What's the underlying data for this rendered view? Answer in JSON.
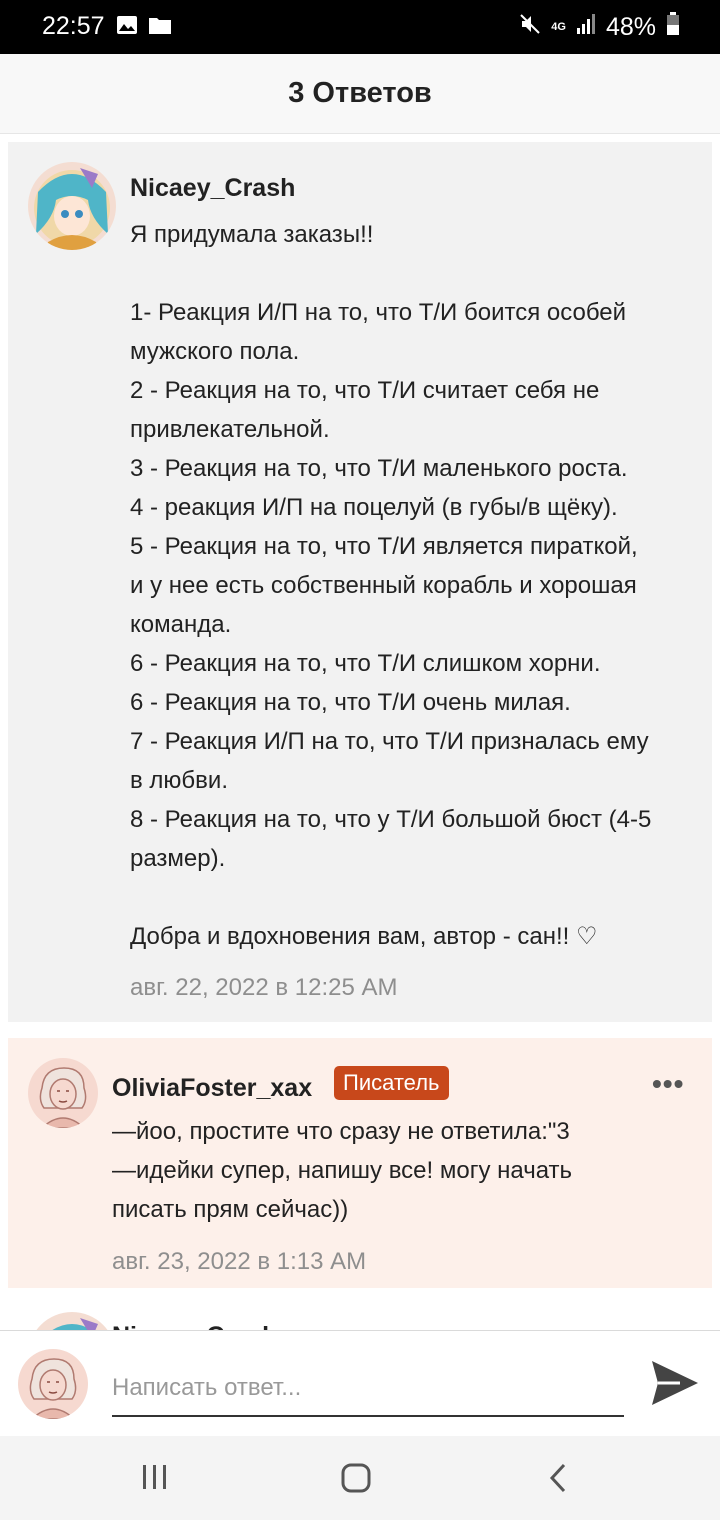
{
  "status_bar": {
    "time": "22:57",
    "network": "4G",
    "battery": "48%"
  },
  "header": {
    "title": "3 Ответов"
  },
  "comments": [
    {
      "username": "Nicaey_Crash",
      "text": "Я придумала заказы!!\n\n1- Реакция И/П на то, что Т/И боится особей\nмужского пола.\n2 - Реакция на то, что Т/И считает себя не\nпривлекательной.\n3 - Реакция на то, что Т/И маленького роста.\n4 - реакция И/П на поцелуй (в губы/в щёку).\n5 - Реакция на то, что Т/И является пираткой,\nи у нее есть собственный корабль и хорошая\nкоманда.\n6 - Реакция на то, что Т/И слишком хорни.\n6 - Реакция на то, что Т/И очень милая.\n7 - Реакция И/П на то, что Т/И призналась ему\nв любви.\n8 - Реакция на то, что у Т/И большой бюст (4-5\nразмер).\n\nДобра и вдохновения вам, автор - сан!! ♡",
      "timestamp": "авг. 22, 2022 в 12:25 AM"
    },
    {
      "username": "OliviaFoster_xax",
      "badge": "Писатель",
      "more": "•••",
      "text": "—йоо, простите что сразу не ответила:\"3\n—идейки супер, напишу все! могу начать\nписать прям сейчас))",
      "timestamp": "авг. 23, 2022 в 1:13 AM"
    },
    {
      "username": "Nicaey_Crash"
    }
  ],
  "compose": {
    "placeholder": "Написать ответ..."
  },
  "colors": {
    "badge": "#c8481b",
    "author_card": "#fdf0ea",
    "card": "#f2f2f2"
  }
}
